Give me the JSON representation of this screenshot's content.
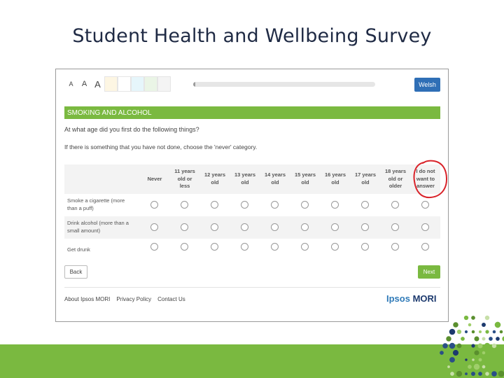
{
  "slide": {
    "title": "Student Health and Wellbeing Survey"
  },
  "toolbar": {
    "text_size_buttons": [
      "A",
      "A",
      "A"
    ]
  },
  "progress": {
    "fraction": 0.01
  },
  "language_button": {
    "label": "Welsh",
    "color": "#2f6fb6"
  },
  "section": {
    "title": "SMOKING AND ALCOHOL",
    "color": "#7ab940"
  },
  "question": {
    "text": "At what age did you first do the following things?",
    "instruction": "If there is something that you have not done, choose the 'never' category."
  },
  "grid": {
    "columns": [
      [
        "Never"
      ],
      [
        "11 years",
        "old or",
        "less"
      ],
      [
        "12 years",
        "old"
      ],
      [
        "13 years",
        "old"
      ],
      [
        "14 years",
        "old"
      ],
      [
        "15 years",
        "old"
      ],
      [
        "16 years",
        "old"
      ],
      [
        "17 years",
        "old"
      ],
      [
        "18 years",
        "old or",
        "older"
      ],
      [
        "I do not",
        "want to",
        "answer"
      ]
    ],
    "rows": [
      [
        "Smoke a cigarette (more",
        "than a puff)"
      ],
      [
        "Drink alcohol (more than a",
        "small amount)"
      ],
      [
        "Get drunk"
      ]
    ]
  },
  "nav": {
    "back_label": "Back",
    "next_label": "Next"
  },
  "footer": {
    "links": [
      "About Ipsos MORI",
      "Privacy Policy",
      "Contact Us"
    ],
    "logo_part1": "Ipsos",
    "logo_part2": "MORI"
  },
  "colors": {
    "accent_green": "#7ab940",
    "annotation_red": "#d9232a",
    "brand_navy": "#1d3a6e",
    "brand_blue": "#2f7ab8"
  }
}
